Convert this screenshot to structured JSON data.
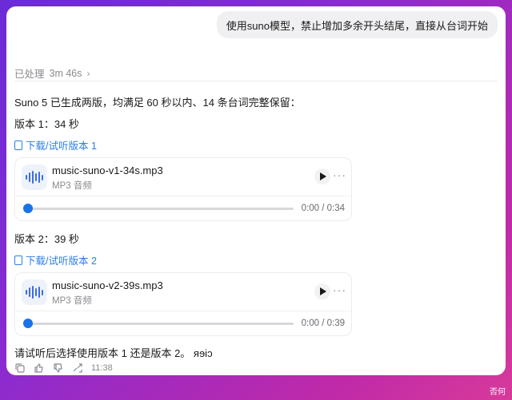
{
  "user_message": "使用suno模型，禁止增加多余开头结尾，直接从台词开始",
  "processed": {
    "label": "已处理",
    "duration": "3m 46s"
  },
  "reply": {
    "intro": "Suno 5 已生成两版，均满足 60 秒以内、14 条台词完整保留：",
    "versions": [
      {
        "title": "版本 1：34 秒",
        "link": "下载/试听版本 1",
        "file_name": "music-suno-v1-34s.mp3",
        "file_type": "MP3 音频",
        "time": "0:00 / 0:34"
      },
      {
        "title": "版本 2：39 秒",
        "link": "下载/试听版本 2",
        "file_name": "music-suno-v2-39s.mp3",
        "file_type": "MP3 音频",
        "time": "0:00 / 0:39"
      }
    ],
    "closing": "请试听后选择使用版本 1 还是版本 2。 ᴙɘiɔ"
  },
  "message_time": "11:38",
  "watermark": "否何",
  "icons": {
    "file": "file-icon",
    "audio": "waveform-icon",
    "play": "play-icon",
    "more": "more-icon",
    "copy": "copy-icon",
    "like": "thumbs-up-icon",
    "dislike": "thumbs-down-icon",
    "share": "share-icon"
  },
  "colors": {
    "link": "#2b7de9",
    "progress_knob": "#1a73e8"
  }
}
